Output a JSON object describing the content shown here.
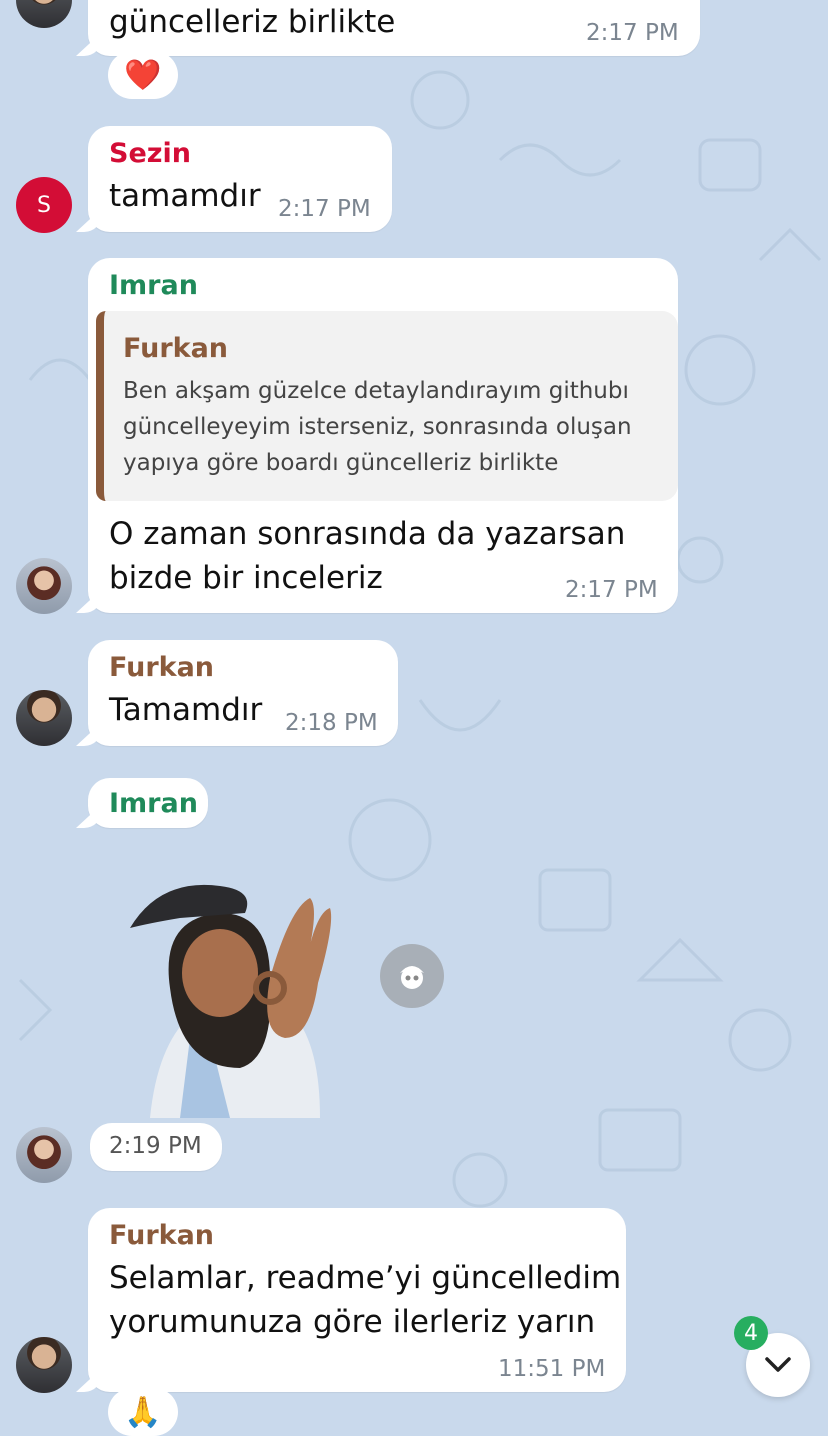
{
  "messages": [
    {
      "id": "m1",
      "text": "güncelleriz birlikte",
      "time": "2:17 PM",
      "reaction": "❤️"
    },
    {
      "id": "m2",
      "sender": "Sezin",
      "sender_color": "#d30d36",
      "text": "tamamdır",
      "time": "2:17 PM",
      "avatar_letter": "S"
    },
    {
      "id": "m3",
      "sender": "Imran",
      "sender_color": "#1f8a5a",
      "quote": {
        "sender": "Furkan",
        "lines": [
          "Ben akşam güzelce detaylandırayım githubı",
          "güncelleyeyim isterseniz, sonrasında oluşan",
          "yapıya göre boardı güncelleriz birlikte"
        ]
      },
      "lines": [
        "O zaman sonrasında da yazarsan",
        "bizde bir inceleriz"
      ],
      "time": "2:17 PM"
    },
    {
      "id": "m4",
      "sender": "Furkan",
      "sender_color": "#8a5a3b",
      "text": "Tamamdır",
      "time": "2:18 PM"
    },
    {
      "id": "m5",
      "sender": "Imran",
      "sender_color": "#1f8a5a"
    },
    {
      "id": "m6",
      "type": "sticker",
      "time": "2:19 PM"
    },
    {
      "id": "m7",
      "sender": "Furkan",
      "sender_color": "#8a5a3b",
      "lines": [
        "Selamlar, readme’yi güncelledim",
        "yorumunuza göre ilerleriz yarın"
      ],
      "time": "11:51 PM",
      "reaction": "🙏"
    }
  ],
  "scroll_down": {
    "unread_count": "4"
  },
  "colors": {
    "background": "#c9d9ec",
    "bubble": "#ffffff",
    "badge": "#27ae60"
  }
}
